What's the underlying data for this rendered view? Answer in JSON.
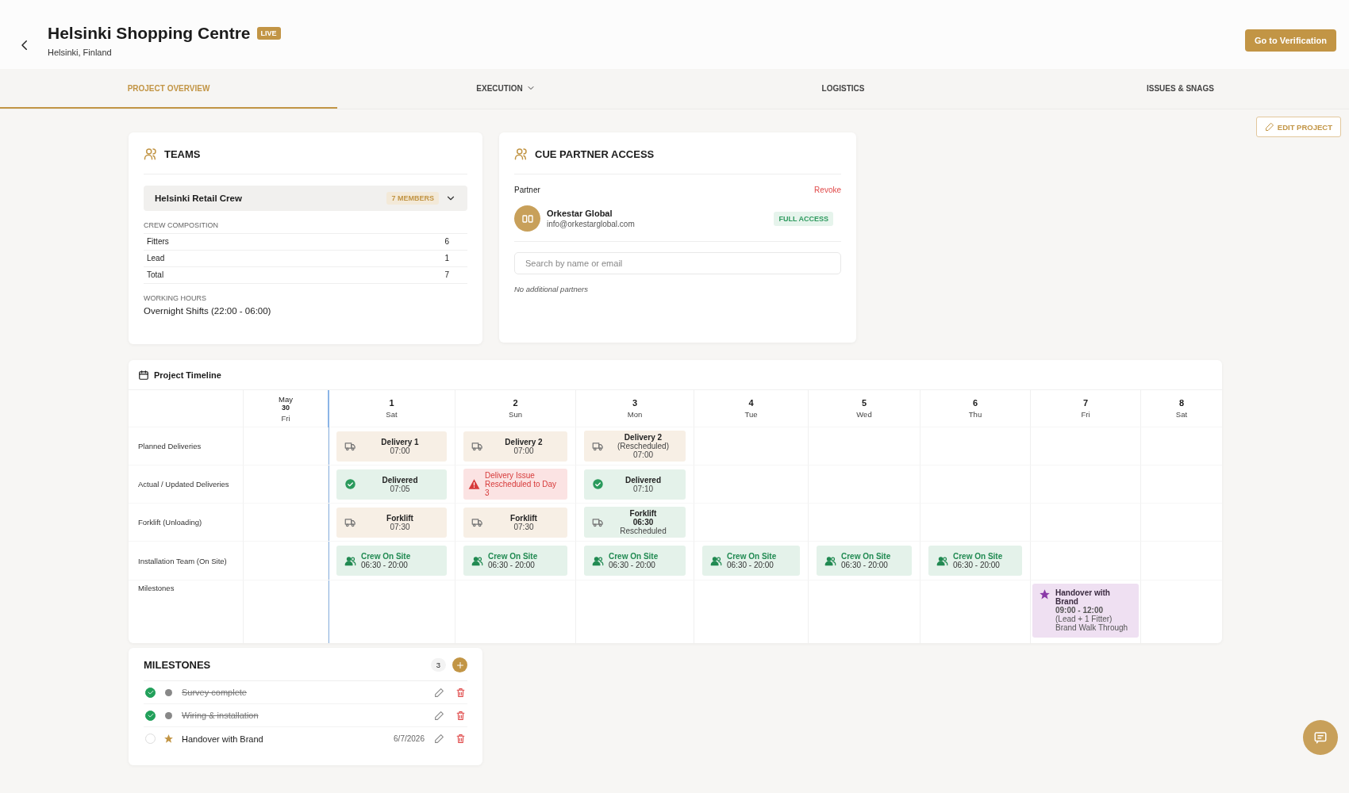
{
  "header": {
    "title": "Helsinki Shopping Centre",
    "status_badge": "LIVE",
    "location": "Helsinki, Finland",
    "primary_button": "Go to Verification"
  },
  "tabs": [
    {
      "label": "PROJECT OVERVIEW",
      "selected": true,
      "has_menu": false
    },
    {
      "label": "EXECUTION",
      "selected": false,
      "has_menu": true
    },
    {
      "label": "LOGISTICS",
      "selected": false,
      "has_menu": false
    },
    {
      "label": "ISSUES & SNAGS",
      "selected": false,
      "has_menu": false
    }
  ],
  "edit_button": "EDIT PROJECT",
  "teams": {
    "title": "TEAMS",
    "team": {
      "name": "Helsinki Retail Crew",
      "members": "7 MEMBERS",
      "expanded": false
    },
    "composition_label": "CREW COMPOSITION",
    "composition": [
      {
        "role": "Fitters",
        "count": "6"
      },
      {
        "role": "Lead",
        "count": "1"
      },
      {
        "role": "Total",
        "count": "7"
      }
    ],
    "hours_label": "WORKING HOURS",
    "hours": "Overnight Shifts (22:00 - 06:00)"
  },
  "partner_access": {
    "title": "CUE PARTNER ACCESS",
    "partner_label": "Partner",
    "revoke": "Revoke",
    "partner": {
      "name": "Orkestar Global",
      "email": "info@orkestarglobal.com",
      "access": "FULL ACCESS"
    },
    "search": {
      "placeholder": "Search by name or email"
    },
    "empty_note": "No additional partners"
  },
  "timeline": {
    "title": "Project Timeline",
    "columns": [
      {
        "date": "May",
        "day": "30",
        "weekday": "Fri",
        "today_marker": false
      },
      {
        "day": "1",
        "weekday": "Sat",
        "today_marker": true
      },
      {
        "day": "2",
        "weekday": "Sun",
        "today_marker": false
      },
      {
        "day": "3",
        "weekday": "Mon",
        "today_marker": false
      },
      {
        "day": "4",
        "weekday": "Tue",
        "today_marker": false
      },
      {
        "day": "5",
        "weekday": "Wed",
        "today_marker": false
      },
      {
        "day": "6",
        "weekday": "Thu",
        "today_marker": false
      },
      {
        "day": "7",
        "weekday": "Fri",
        "today_marker": false
      },
      {
        "day": "8",
        "weekday": "Sat",
        "today_marker": false
      }
    ],
    "rows": [
      {
        "label": "Planned Deliveries",
        "cells": [
          {
            "kind": "empty"
          },
          {
            "kind": "planned",
            "title": "Delivery 1",
            "lines": [
              {
                "text": "07:00",
                "bold": false
              }
            ]
          },
          {
            "kind": "planned",
            "title": "Delivery 2",
            "lines": [
              {
                "text": "07:00",
                "bold": false
              }
            ]
          },
          {
            "kind": "planned",
            "title": "Delivery 2",
            "lines": [
              {
                "text": "(Rescheduled)",
                "bold": false
              },
              {
                "text": "07:00",
                "bold": false
              }
            ]
          },
          {
            "kind": "empty"
          },
          {
            "kind": "empty"
          },
          {
            "kind": "empty"
          },
          {
            "kind": "empty"
          },
          {
            "kind": "empty"
          }
        ]
      },
      {
        "label": "Actual / Updated Deliveries",
        "cells": [
          {
            "kind": "empty"
          },
          {
            "kind": "delivered",
            "title": "Delivered",
            "lines": [
              {
                "text": "07:05",
                "bold": false
              }
            ]
          },
          {
            "kind": "issue",
            "title": "Delivery Issue",
            "lines": [
              {
                "text": "Rescheduled to Day 3",
                "bold": false
              }
            ]
          },
          {
            "kind": "delivered",
            "title": "Delivered",
            "lines": [
              {
                "text": "07:10",
                "bold": false
              }
            ]
          },
          {
            "kind": "empty"
          },
          {
            "kind": "empty"
          },
          {
            "kind": "empty"
          },
          {
            "kind": "empty"
          },
          {
            "kind": "empty"
          }
        ]
      },
      {
        "label": "Forklift (Unloading)",
        "cells": [
          {
            "kind": "empty"
          },
          {
            "kind": "planned",
            "title": "Forklift",
            "lines": [
              {
                "text": "07:30",
                "bold": false
              }
            ]
          },
          {
            "kind": "planned",
            "title": "Forklift",
            "lines": [
              {
                "text": "07:30",
                "bold": false
              }
            ]
          },
          {
            "kind": "rescheduled",
            "title": "Forklift",
            "lines": [
              {
                "text": "06:30",
                "bold": true
              },
              {
                "text": "Rescheduled",
                "bold": false
              }
            ]
          },
          {
            "kind": "empty"
          },
          {
            "kind": "empty"
          },
          {
            "kind": "empty"
          },
          {
            "kind": "empty"
          },
          {
            "kind": "empty"
          }
        ]
      },
      {
        "label": "Installation Team (On Site)",
        "cells": [
          {
            "kind": "empty"
          },
          {
            "kind": "crew",
            "title": "Crew On Site",
            "lines": [
              {
                "text": "06:30 - 20:00",
                "bold": false
              }
            ]
          },
          {
            "kind": "crew",
            "title": "Crew On Site",
            "lines": [
              {
                "text": "06:30 - 20:00",
                "bold": false
              }
            ]
          },
          {
            "kind": "crew",
            "title": "Crew On Site",
            "lines": [
              {
                "text": "06:30 - 20:00",
                "bold": false
              }
            ]
          },
          {
            "kind": "crew",
            "title": "Crew On Site",
            "lines": [
              {
                "text": "06:30 - 20:00",
                "bold": false
              }
            ]
          },
          {
            "kind": "crew",
            "title": "Crew On Site",
            "lines": [
              {
                "text": "06:30 - 20:00",
                "bold": false
              }
            ]
          },
          {
            "kind": "crew",
            "title": "Crew On Site",
            "lines": [
              {
                "text": "06:30 - 20:00",
                "bold": false
              }
            ]
          },
          {
            "kind": "empty"
          },
          {
            "kind": "empty"
          }
        ]
      },
      {
        "label": "Milestones",
        "cells": [
          {
            "kind": "empty"
          },
          {
            "kind": "empty"
          },
          {
            "kind": "empty"
          },
          {
            "kind": "empty"
          },
          {
            "kind": "empty"
          },
          {
            "kind": "empty"
          },
          {
            "kind": "empty"
          },
          {
            "kind": "milestone",
            "title": "Handover with Brand",
            "lines": [
              {
                "text": "09:00 - 12:00",
                "bold": true
              },
              {
                "text": "(Lead + 1 Fitter)",
                "bold": false
              },
              {
                "text": "Brand Walk Through",
                "bold": false
              }
            ]
          },
          {
            "kind": "empty"
          }
        ]
      }
    ]
  },
  "milestones": {
    "title": "MILESTONES",
    "count": "3",
    "items": [
      {
        "title": "Survey complete",
        "checked": true,
        "kind": "dot"
      },
      {
        "title": "Wiring & installation",
        "checked": true,
        "kind": "dot"
      },
      {
        "title": "Handover with Brand",
        "checked": false,
        "kind": "star",
        "date": "6/7/2026"
      }
    ]
  }
}
